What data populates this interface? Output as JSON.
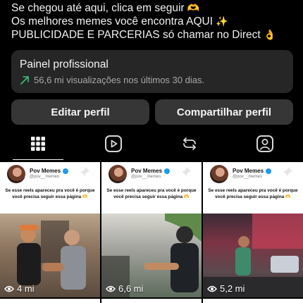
{
  "bio": {
    "line1": "Se chegou até aqui, clica em seguir",
    "line1_emoji": "🫶",
    "line2": "Os melhores memes você encontra AQUI",
    "line2_emoji": "✨",
    "line3": "PUBLICIDADE E PARCERIAS só chamar no Direct",
    "line3_emoji": "👌"
  },
  "pro_panel": {
    "title": "Painel profissional",
    "stats": "56,6 mi visualizações nos últimos 30 dias.",
    "trend_color": "#3ec17a"
  },
  "actions": {
    "edit_label": "Editar perfil",
    "share_label": "Compartilhar perfil"
  },
  "tabs": [
    {
      "name": "grid",
      "active": true
    },
    {
      "name": "reels",
      "active": false
    },
    {
      "name": "reposts",
      "active": false
    },
    {
      "name": "tagged",
      "active": false
    }
  ],
  "posts": [
    {
      "account": "Pov Memes",
      "handle": "@pov__memes",
      "caption": "Se esse reels apareceu pra você é porque você precisa seguir essa página 🫶",
      "views": "4 mi"
    },
    {
      "account": "Pov Memes",
      "handle": "@pov__memes",
      "caption": "Se esse reels apareceu pra você é porque você precisa seguir essa página 🫶",
      "views": "6,6 mi"
    },
    {
      "account": "Pov Memes",
      "handle": "@pov__memes",
      "caption": "Se esse reels apareceu pra você é porque você precisa seguir essa página 🫶",
      "views": "5,2 mi"
    }
  ]
}
